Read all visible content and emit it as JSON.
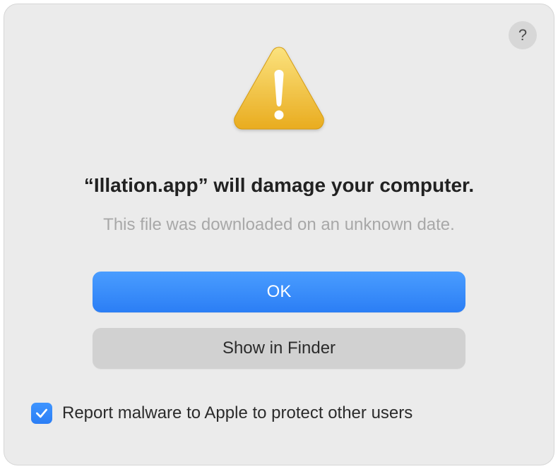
{
  "dialog": {
    "help_label": "?",
    "heading": "“Illation.app” will damage your computer.",
    "subtext": "This file was downloaded on an unknown date.",
    "primary_button": "OK",
    "secondary_button": "Show in Finder",
    "checkbox_label": "Report malware to Apple to protect other users",
    "checkbox_checked": true
  }
}
